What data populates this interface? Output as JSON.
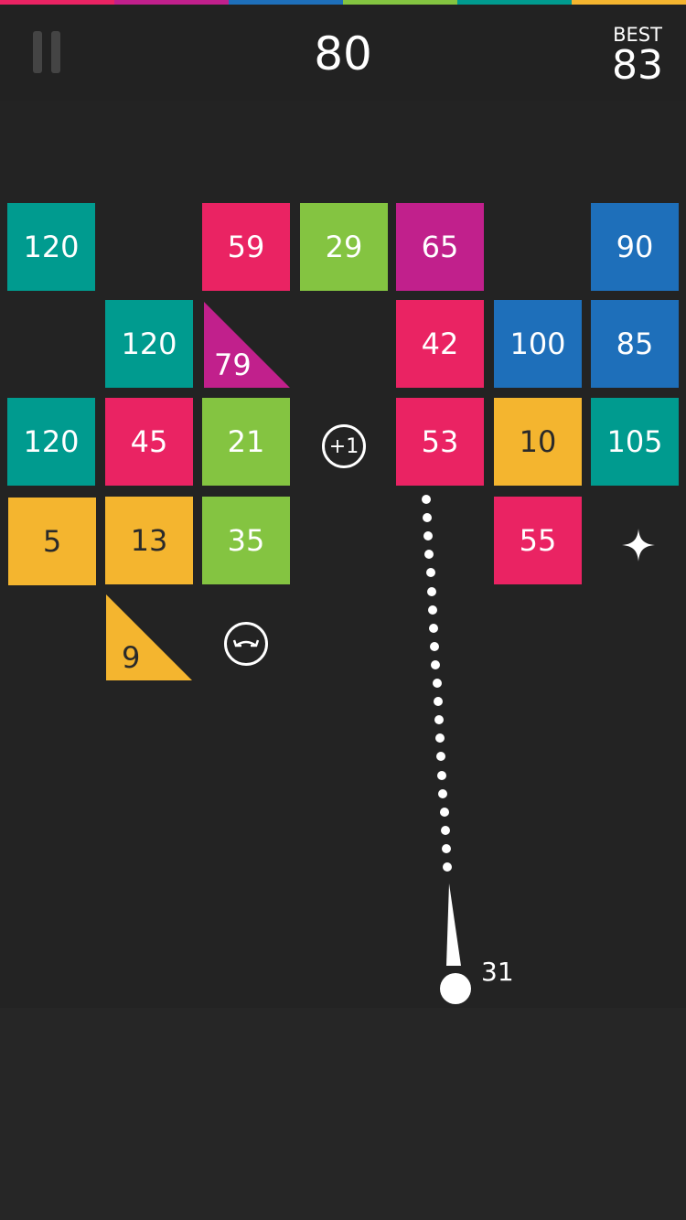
{
  "header": {
    "score": "80",
    "best_label": "BEST",
    "best_value": "83"
  },
  "colors": {
    "background": "#222222",
    "pink": "#ea2363",
    "magenta": "#c1208c",
    "blue": "#1e6fba",
    "green": "#84c441",
    "teal": "#009b8f",
    "yellow": "#f4b52f",
    "top_bar": [
      "#ea2363",
      "#c1208c",
      "#1e6fba",
      "#84c441",
      "#009b8f",
      "#f4b52f"
    ]
  },
  "blocks": [
    {
      "id": "r0c0",
      "value": "120",
      "color": "teal"
    },
    {
      "id": "r0c2",
      "value": "59",
      "color": "pink"
    },
    {
      "id": "r0c3",
      "value": "29",
      "color": "green"
    },
    {
      "id": "r0c4",
      "value": "65",
      "color": "magenta"
    },
    {
      "id": "r0c6",
      "value": "90",
      "color": "blue"
    },
    {
      "id": "r1c1",
      "value": "120",
      "color": "teal"
    },
    {
      "id": "r1c4",
      "value": "42",
      "color": "pink"
    },
    {
      "id": "r1c5",
      "value": "100",
      "color": "blue"
    },
    {
      "id": "r1c6",
      "value": "85",
      "color": "blue"
    },
    {
      "id": "r2c0",
      "value": "120",
      "color": "teal"
    },
    {
      "id": "r2c1",
      "value": "45",
      "color": "pink"
    },
    {
      "id": "r2c2",
      "value": "21",
      "color": "green"
    },
    {
      "id": "r2c4",
      "value": "53",
      "color": "pink"
    },
    {
      "id": "r2c5",
      "value": "10",
      "color": "yellow"
    },
    {
      "id": "r2c6",
      "value": "105",
      "color": "teal"
    },
    {
      "id": "r3c0",
      "value": "5",
      "color": "yellow"
    },
    {
      "id": "r3c1",
      "value": "13",
      "color": "yellow"
    },
    {
      "id": "r3c2",
      "value": "35",
      "color": "green"
    },
    {
      "id": "r3c5",
      "value": "55",
      "color": "pink"
    }
  ],
  "triangles": [
    {
      "id": "r1c2",
      "value": "79",
      "color": "magenta"
    },
    {
      "id": "r4c1",
      "value": "9",
      "color": "yellow"
    }
  ],
  "powerups": {
    "extra_ball": "+1",
    "spread_icon": "bounce-arrows-icon",
    "star_icon": "sparkle-star-icon"
  },
  "launcher": {
    "ball_count": "31"
  }
}
